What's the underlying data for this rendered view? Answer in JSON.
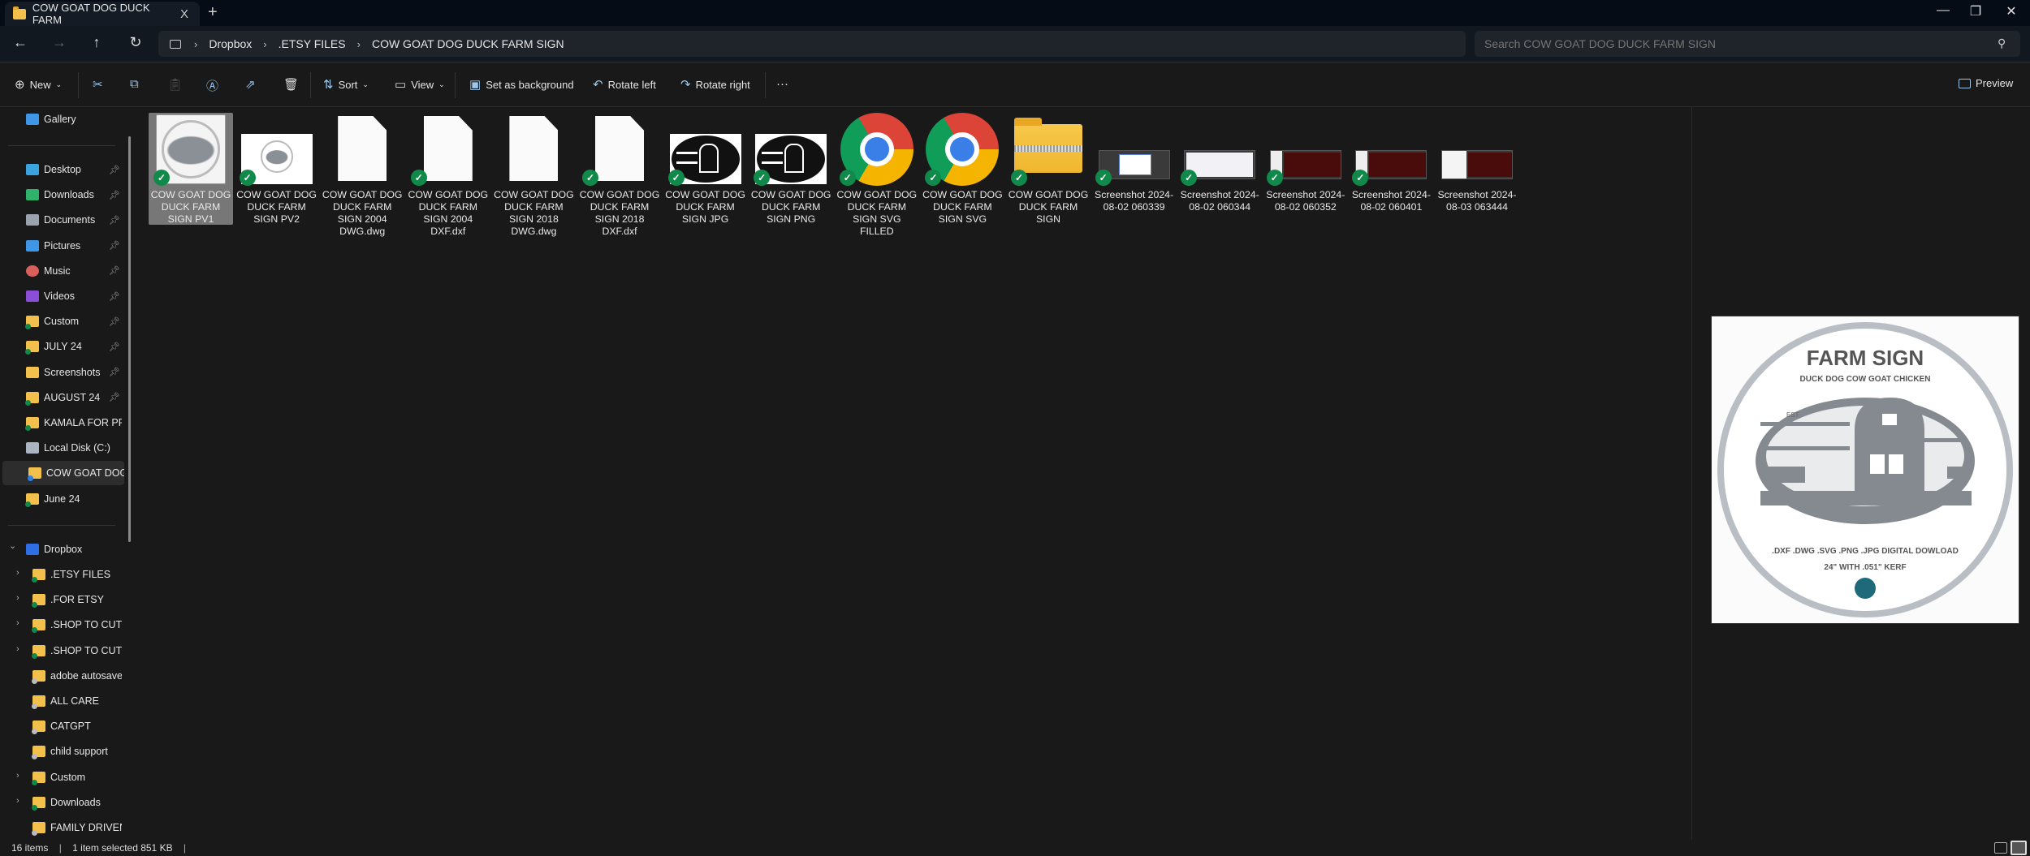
{
  "window": {
    "tab_title": "COW GOAT DOG DUCK FARM",
    "new_tab": "+",
    "close_tab": "X",
    "minimize": "—",
    "restore": "❐",
    "close": "✕"
  },
  "address": {
    "crumbs": [
      "Dropbox",
      ".ETSY FILES",
      "COW GOAT DOG DUCK FARM SIGN"
    ],
    "search_placeholder": "Search COW GOAT DOG DUCK FARM SIGN"
  },
  "toolbar": {
    "new": "New",
    "sort": "Sort",
    "view": "View",
    "set_background": "Set as background",
    "rotate_left": "Rotate left",
    "rotate_right": "Rotate right",
    "more": "···",
    "preview": "Preview"
  },
  "sidebar": {
    "gallery": "Gallery",
    "quick": [
      {
        "label": "Desktop",
        "icon": "desktop",
        "pinned": true
      },
      {
        "label": "Downloads",
        "icon": "downloads",
        "pinned": true
      },
      {
        "label": "Documents",
        "icon": "documents",
        "pinned": true
      },
      {
        "label": "Pictures",
        "icon": "pictures",
        "pinned": true
      },
      {
        "label": "Music",
        "icon": "music",
        "pinned": true
      },
      {
        "label": "Videos",
        "icon": "videos",
        "pinned": true
      },
      {
        "label": "Custom",
        "icon": "folder-synced",
        "pinned": true
      },
      {
        "label": "JULY 24",
        "icon": "folder-synced",
        "pinned": true
      },
      {
        "label": "Screenshots",
        "icon": "folder",
        "pinned": true
      },
      {
        "label": "AUGUST 24",
        "icon": "folder-synced",
        "pinned": true
      },
      {
        "label": "KAMALA FOR PRES",
        "icon": "folder-synced",
        "pinned": false
      },
      {
        "label": "Local Disk (C:)",
        "icon": "drive",
        "pinned": false
      },
      {
        "label": "COW GOAT DOG DUCK",
        "icon": "folder-syncing",
        "pinned": false,
        "selected": true
      },
      {
        "label": "June 24",
        "icon": "folder-synced",
        "pinned": false
      }
    ],
    "dropbox": "Dropbox",
    "tree": [
      {
        "label": ".ETSY FILES",
        "expandable": true,
        "sync": "synced"
      },
      {
        "label": ".FOR ETSY",
        "expandable": true,
        "sync": "synced"
      },
      {
        "label": ".SHOP TO CUT",
        "expandable": true,
        "sync": "synced"
      },
      {
        "label": ".SHOP TO CUT - C",
        "expandable": true,
        "sync": "synced"
      },
      {
        "label": "adobe autosave",
        "expandable": false,
        "sync": "online"
      },
      {
        "label": "ALL CARE",
        "expandable": false,
        "sync": "online"
      },
      {
        "label": "CATGPT",
        "expandable": false,
        "sync": "online"
      },
      {
        "label": "child support",
        "expandable": false,
        "sync": "online"
      },
      {
        "label": "Custom",
        "expandable": true,
        "sync": "synced"
      },
      {
        "label": "Downloads",
        "expandable": true,
        "sync": "synced"
      },
      {
        "label": "FAMILY DRIVEN",
        "expandable": false,
        "sync": "online"
      }
    ]
  },
  "files": [
    {
      "name": "COW GOAT DOG DUCK FARM SIGN  PV1",
      "type": "sign-image",
      "synced": true,
      "selected": true
    },
    {
      "name": "COW GOAT DOG DUCK FARM SIGN  PV2",
      "type": "sign-image-small",
      "synced": true
    },
    {
      "name": "COW GOAT DOG DUCK FARM SIGN 2004 DWG.dwg",
      "type": "document",
      "synced": false
    },
    {
      "name": "COW GOAT DOG DUCK FARM SIGN 2004 DXF.dxf",
      "type": "document",
      "synced": true
    },
    {
      "name": "COW GOAT DOG DUCK FARM SIGN 2018 DWG.dwg",
      "type": "document",
      "synced": false
    },
    {
      "name": "COW GOAT DOG DUCK FARM SIGN 2018 DXF.dxf",
      "type": "document",
      "synced": true
    },
    {
      "name": "COW GOAT DOG DUCK FARM SIGN JPG",
      "type": "bw-sign",
      "synced": true
    },
    {
      "name": "COW GOAT DOG DUCK FARM SIGN PNG",
      "type": "bw-sign",
      "synced": true
    },
    {
      "name": "COW GOAT DOG DUCK FARM SIGN SVG FILLED",
      "type": "chrome",
      "synced": true
    },
    {
      "name": "COW GOAT DOG DUCK FARM SIGN SVG",
      "type": "chrome",
      "synced": true
    },
    {
      "name": "COW GOAT DOG DUCK FARM SIGN",
      "type": "zip",
      "synced": true
    },
    {
      "name": "Screenshot 2024-08-02 060339",
      "type": "screenshot-blue",
      "synced": true
    },
    {
      "name": "Screenshot 2024-08-02 060344",
      "type": "screenshot-white",
      "synced": true
    },
    {
      "name": "Screenshot 2024-08-02 060352",
      "type": "screenshot-red",
      "synced": true
    },
    {
      "name": "Screenshot 2024-08-02 060401",
      "type": "screenshot-red",
      "synced": true
    },
    {
      "name": "Screenshot 2024-08-03 063444",
      "type": "screenshot-red-white",
      "synced": false
    }
  ],
  "preview": {
    "title": "FARM SIGN",
    "subtitle": "DUCK DOG COW GOAT CHICKEN",
    "est": "EST.",
    "formats": ".DXF .DWG .SVG .PNG .JPG DIGITAL DOWLOAD",
    "size": "24\" WITH .051\" KERF"
  },
  "status": {
    "count": "16 items",
    "selection": "1 item selected  851 KB"
  },
  "colors": {
    "sync_green": "#11894a",
    "folder": "#f3c14b",
    "accent": "#9cc6ea"
  }
}
